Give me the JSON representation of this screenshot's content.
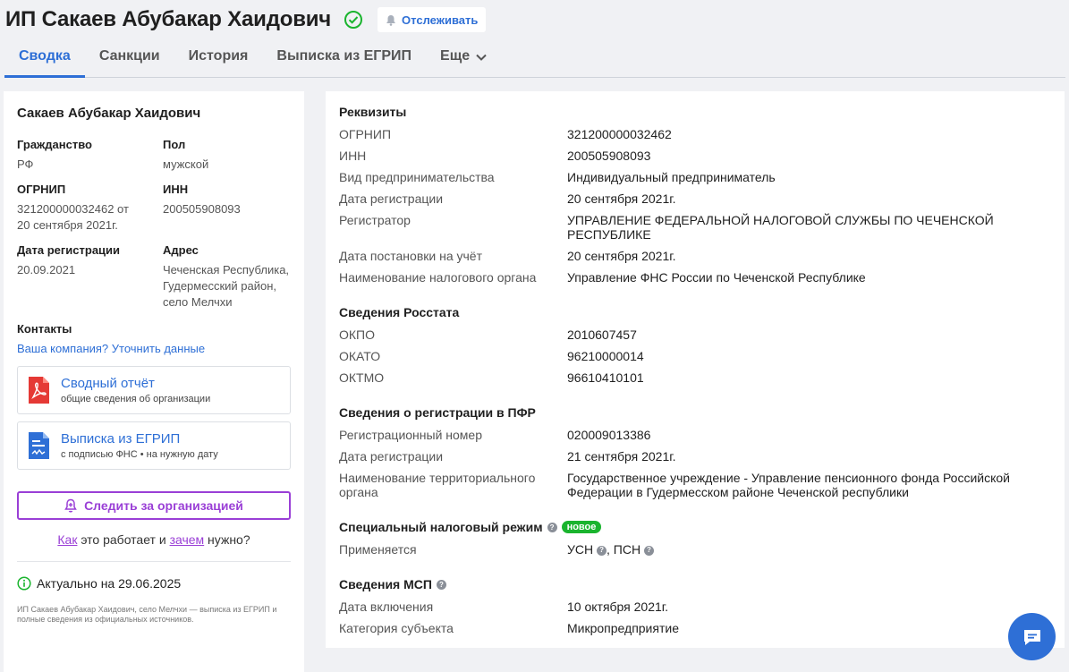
{
  "header": {
    "title": "ИП Сакаев Абубакар Хаидович",
    "track_label": "Отслеживать",
    "tabs": [
      {
        "label": "Сводка",
        "active": true
      },
      {
        "label": "Санкции"
      },
      {
        "label": "История"
      },
      {
        "label": "Выписка из ЕГРИП"
      },
      {
        "label": "Еще"
      }
    ]
  },
  "left": {
    "name": "Сакаев Абубакар Хаидович",
    "citizenship_label": "Гражданство",
    "citizenship_value": "РФ",
    "gender_label": "Пол",
    "gender_value": "мужской",
    "ogrnip_label": "ОГРНИП",
    "ogrnip_value": "321200000032462 от 20 сентября 2021г.",
    "inn_label": "ИНН",
    "inn_value": "200505908093",
    "regdate_label": "Дата регистрации",
    "regdate_value": "20.09.2021",
    "address_label": "Адрес",
    "address_value": "Чеченская Республика, Гудермесский район, село Мелчхи",
    "contacts_title": "Контакты",
    "contacts_link": "Ваша компания? Уточнить данные",
    "doc1_title": "Сводный отчёт",
    "doc1_sub": "общие сведения об организации",
    "doc2_title": "Выписка из ЕГРИП",
    "doc2_sub": "с подписью ФНС • на нужную дату",
    "follow_label": "Следить за организацией",
    "how_link1": "Как",
    "how_mid": " это работает и ",
    "how_link2": "зачем",
    "how_end": " нужно?",
    "actual": "Актуально на 29.06.2025",
    "footnote": "ИП Сакаев Абубакар Хаидович, село Мелчхи — выписка из ЕГРИП и полные сведения из официальных источников."
  },
  "right": {
    "requisites": {
      "title": "Реквизиты",
      "rows": [
        {
          "label": "ОГРНИП",
          "value": "321200000032462"
        },
        {
          "label": "ИНН",
          "value": "200505908093"
        },
        {
          "label": "Вид предпринимательства",
          "value": "Индивидуальный предприниматель"
        },
        {
          "label": "Дата регистрации",
          "value": "20 сентября 2021г."
        },
        {
          "label": "Регистратор",
          "value": "УПРАВЛЕНИЕ ФЕДЕРАЛЬНОЙ НАЛОГОВОЙ СЛУЖБЫ ПО ЧЕЧЕНСКОЙ РЕСПУБЛИКЕ"
        },
        {
          "label": "Дата постановки на учёт",
          "value": "20 сентября 2021г."
        },
        {
          "label": "Наименование налогового органа",
          "value": "Управление ФНС России по Чеченской Республике"
        }
      ]
    },
    "rosstat": {
      "title": "Сведения Росстата",
      "rows": [
        {
          "label": "ОКПО",
          "value": "2010607457"
        },
        {
          "label": "ОКАТО",
          "value": "96210000014"
        },
        {
          "label": "ОКТМО",
          "value": "96610410101"
        }
      ]
    },
    "pfr": {
      "title": "Сведения о регистрации в ПФР",
      "rows": [
        {
          "label": "Регистрационный номер",
          "value": "020009013386"
        },
        {
          "label": "Дата регистрации",
          "value": "21 сентября 2021г."
        },
        {
          "label": "Наименование территориального органа",
          "value": "Государственное учреждение - Управление пенсионного фонда Российской Федерации в Гудермесском районе Чеченской республики"
        }
      ]
    },
    "tax_regime": {
      "title": "Специальный налоговый режим",
      "badge": "новое",
      "applied_label": "Применяется",
      "usn": "УСН",
      "psn": "ПСН"
    },
    "msp": {
      "title": "Сведения МСП",
      "rows": [
        {
          "label": "Дата включения",
          "value": "10 октября 2021г."
        },
        {
          "label": "Категория субъекта",
          "value": "Микропредприятие"
        }
      ]
    }
  }
}
